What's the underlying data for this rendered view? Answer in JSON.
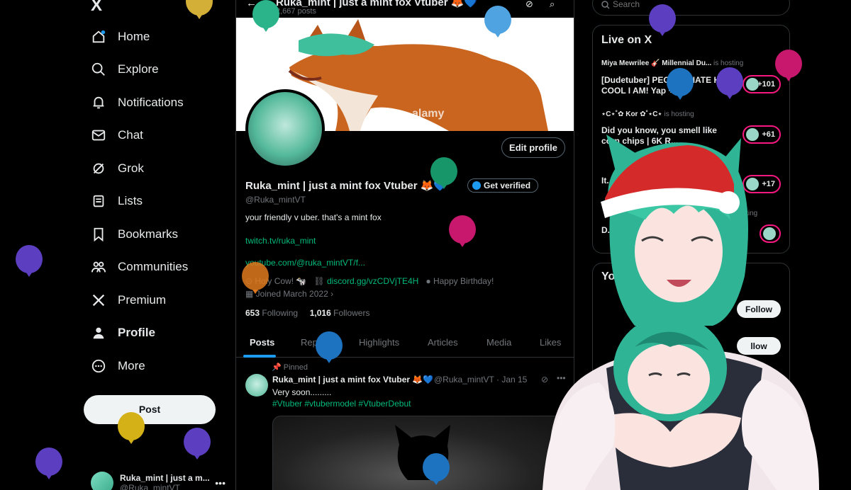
{
  "nav": {
    "logo": "X",
    "items": [
      {
        "label": "Home",
        "icon": "home-icon"
      },
      {
        "label": "Explore",
        "icon": "search-icon"
      },
      {
        "label": "Notifications",
        "icon": "bell-icon"
      },
      {
        "label": "Chat",
        "icon": "envelope-icon"
      },
      {
        "label": "Grok",
        "icon": "grok-icon"
      },
      {
        "label": "Lists",
        "icon": "list-icon"
      },
      {
        "label": "Bookmarks",
        "icon": "bookmark-icon"
      },
      {
        "label": "Communities",
        "icon": "people-icon"
      },
      {
        "label": "Premium",
        "icon": "x-logo-icon"
      },
      {
        "label": "Profile",
        "icon": "person-icon"
      },
      {
        "label": "More",
        "icon": "more-circle-icon"
      }
    ],
    "post_label": "Post",
    "account": {
      "name": "Ruka_mint | just a m...",
      "handle": "@Ruka_mintVT"
    }
  },
  "header": {
    "title": "Ruka_mint | just a mint fox Vtuber 🦊💙",
    "post_count": "2,667 posts"
  },
  "profile": {
    "name": "Ruka_mint | just a mint fox Vtuber 🦊💙",
    "handle": "@Ruka_mintVT",
    "bio": "your friendly v uber. that's a mint fox",
    "link1": "twitch.tv/ruka_mint",
    "link2": "youtube.com/@ruka_mintVT/f...",
    "location": "Holy Cow! 🐄",
    "website": "discord.gg/vzCDVjTE4H",
    "birthday": "Happy Birthday!",
    "joined": "Joined March 2022",
    "following_count": "653",
    "following_label": "Following",
    "followers_count": "1,016",
    "followers_label": "Followers",
    "edit_label": "Edit profile",
    "verify_label": "Get verified",
    "banner_watermark": "alamy"
  },
  "tabs": [
    "Posts",
    "Replies",
    "Highlights",
    "Articles",
    "Media",
    "Likes"
  ],
  "tweet": {
    "pinned_label": "Pinned",
    "author": "Ruka_mint | just a mint fox Vtuber 🦊💙",
    "meta": "@Ruka_mintVT · Jan 15",
    "text": "Very soon.........",
    "tags": "#Vtuber #vtubermodel #VtuberDebut"
  },
  "search": {
    "placeholder": "Search"
  },
  "live": {
    "title": "Live on X",
    "items": [
      {
        "host": "Miya Mewrilee 🎸 Millennial Du...",
        "status": "is hosting",
        "title": "[Dudetuber] PEOPLE HATE HOW COOL I AM! Yap + ...",
        "count": "+101"
      },
      {
        "host": "⋆C⋆˚✿ Kor ✿˚⋆C⋆",
        "status": "is hosting",
        "title": "Did you know, you smell like corn chips | 6K R...",
        "count": "+61"
      },
      {
        "host": "",
        "status": "",
        "title": "It... Yo...",
        "count": "+17"
      },
      {
        "host": "",
        "status": "hosting",
        "title": "D... wr...",
        "count": ""
      }
    ]
  },
  "who_to_follow": {
    "title": "Yo...",
    "follow_label": "Follow",
    "follow_label_partial": "llow"
  },
  "colors": {
    "accent": "#1d9bf0",
    "green": "#00ba7c",
    "live_pink": "#f91880"
  }
}
